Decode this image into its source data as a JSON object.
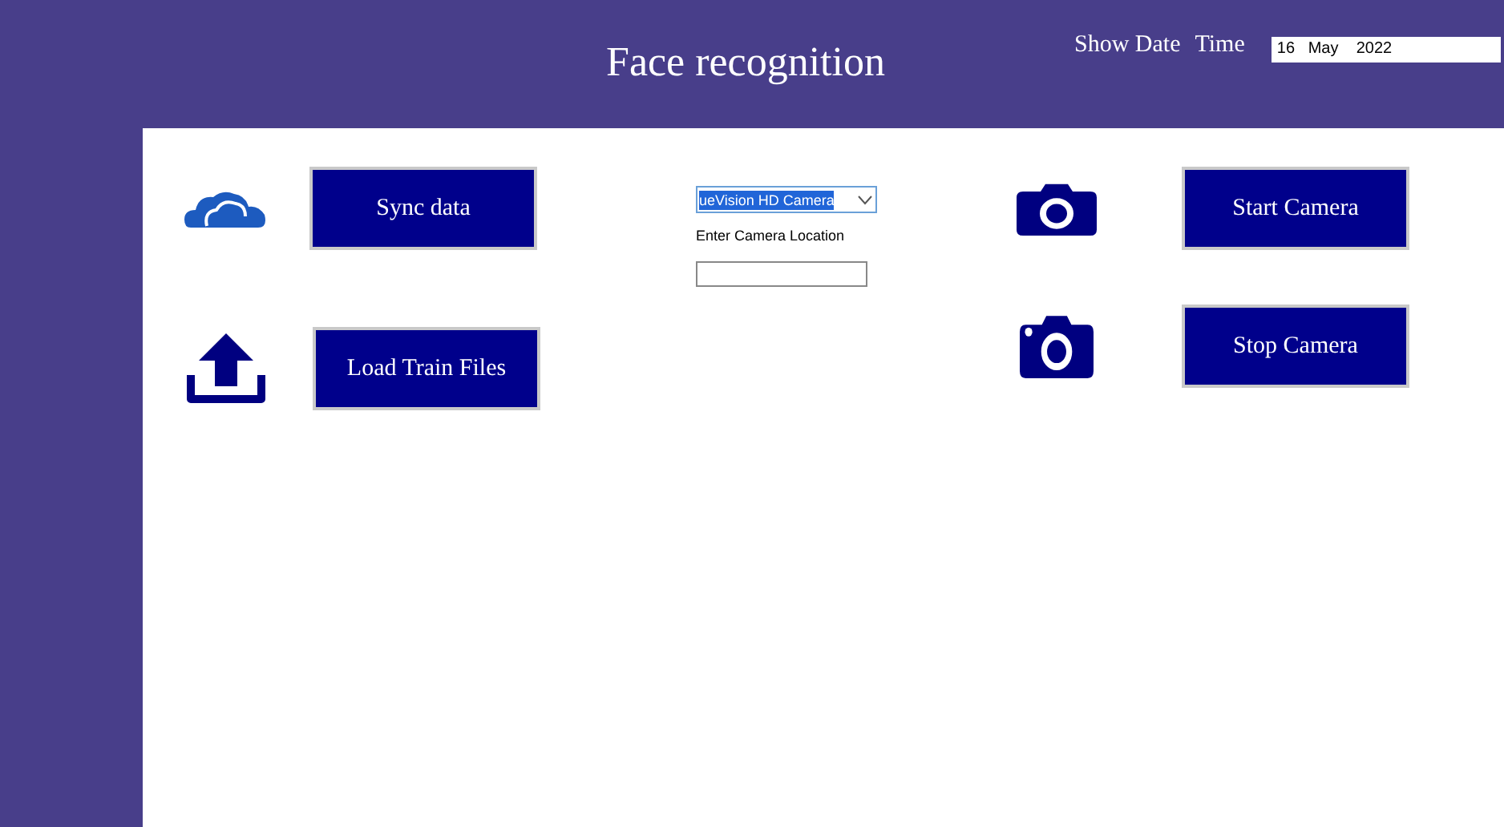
{
  "header": {
    "title": "Face recognition",
    "show_date_label": "Show Date",
    "time_label": "Time",
    "date_value": "16   May    2022"
  },
  "left_actions": [
    {
      "kind": "cloud",
      "label": "Sync data"
    },
    {
      "kind": "upload",
      "label": "Load Train Files"
    }
  ],
  "camera_select": {
    "value": "ueVision HD Camera",
    "location_label": "Enter Camera Location"
  },
  "right_actions": [
    {
      "kind": "camera",
      "label": "Start Camera"
    },
    {
      "kind": "camera-dot",
      "label": "Stop Camera"
    }
  ]
}
